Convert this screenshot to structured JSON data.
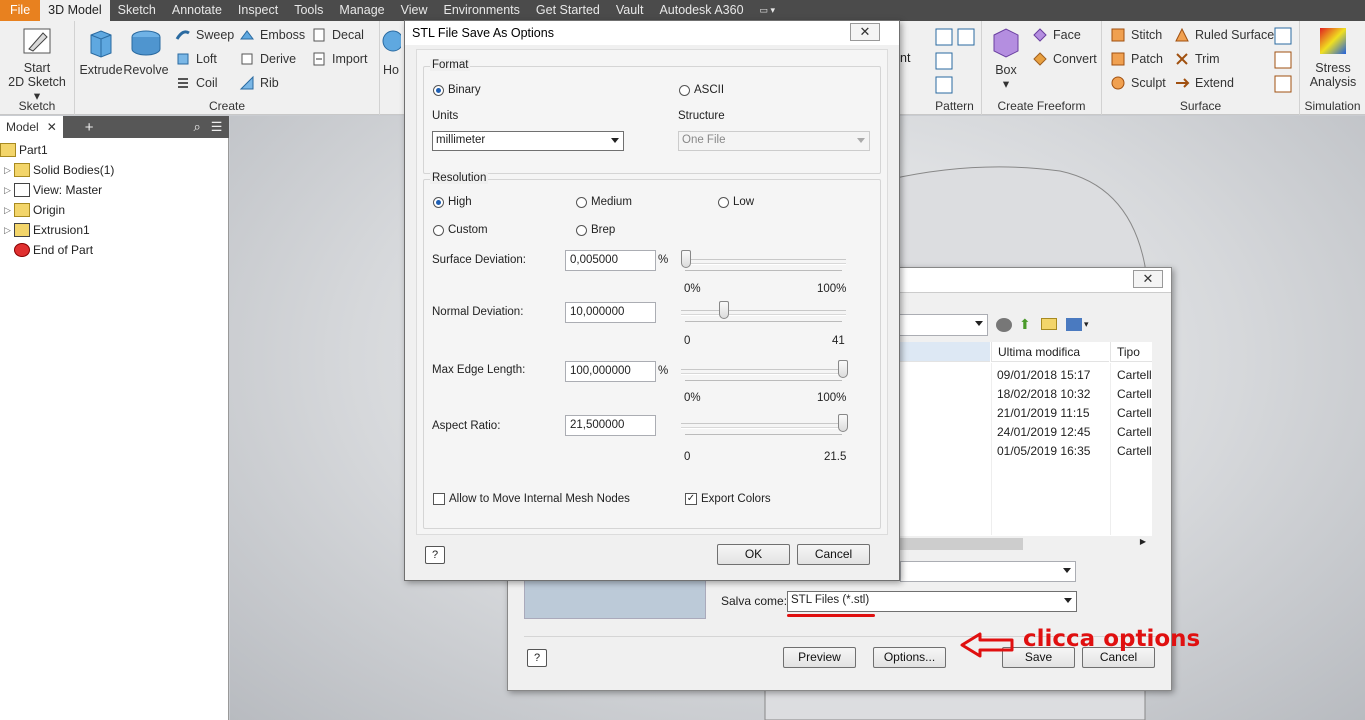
{
  "menu": [
    "File",
    "3D Model",
    "Sketch",
    "Annotate",
    "Inspect",
    "Tools",
    "Manage",
    "View",
    "Environments",
    "Get Started",
    "Vault",
    "Autodesk A360"
  ],
  "ribbon": {
    "sketch": {
      "start_label_1": "Start",
      "start_label_2": "2D Sketch",
      "group": "Sketch"
    },
    "create": {
      "extrude": "Extrude",
      "revolve": "Revolve",
      "sweep": "Sweep",
      "loft": "Loft",
      "coil": "Coil",
      "emboss": "Emboss",
      "derive": "Derive",
      "rib": "Rib",
      "decal": "Decal",
      "import": "Import",
      "hole_partial": "Ho",
      "group": "Create"
    },
    "partial_nt": "nt",
    "pattern": {
      "group": "Pattern"
    },
    "freeform": {
      "box": "Box",
      "face": "Face",
      "convert": "Convert",
      "group": "Create Freeform"
    },
    "surface": {
      "stitch": "Stitch",
      "patch": "Patch",
      "sculpt": "Sculpt",
      "ruled": "Ruled Surface",
      "trim": "Trim",
      "extend": "Extend",
      "group": "Surface"
    },
    "simulation": {
      "stress_1": "Stress",
      "stress_2": "Analysis",
      "group": "Simulation"
    }
  },
  "browser": {
    "tab": "Model",
    "items": [
      "Part1",
      "Solid Bodies(1)",
      "View: Master",
      "Origin",
      "Extrusion1",
      "End of Part"
    ]
  },
  "save_dialog": {
    "columns": [
      "Ultima modifica",
      "Tipo"
    ],
    "rows": [
      {
        "date": "09/01/2018 15:17",
        "type": "Cartell"
      },
      {
        "date": "18/02/2018 10:32",
        "type": "Cartell"
      },
      {
        "date": "21/01/2019 11:15",
        "type": "Cartell"
      },
      {
        "date": "24/01/2019 12:45",
        "type": "Cartell"
      },
      {
        "date": "01/05/2019 16:35",
        "type": "Cartell"
      }
    ],
    "save_as_label": "Salva come:",
    "save_as_value": "STL Files (*.stl)",
    "preview": "Preview",
    "options": "Options...",
    "save": "Save",
    "cancel": "Cancel"
  },
  "stl_dialog": {
    "title": "STL File Save As Options",
    "format_legend": "Format",
    "binary": "Binary",
    "ascii": "ASCII",
    "units_label": "Units",
    "units_value": "millimeter",
    "structure_label": "Structure",
    "structure_value": "One File",
    "resolution_legend": "Resolution",
    "high": "High",
    "medium": "Medium",
    "low": "Low",
    "custom": "Custom",
    "brep": "Brep",
    "surface_dev_label": "Surface Deviation:",
    "surface_dev_value": "0,005000",
    "surface_min": "0%",
    "surface_max": "100%",
    "normal_dev_label": "Normal Deviation:",
    "normal_dev_value": "10,000000",
    "normal_min": "0",
    "normal_max": "41",
    "max_edge_label": "Max Edge Length:",
    "max_edge_value": "100,000000",
    "max_edge_min": "0%",
    "max_edge_max": "100%",
    "aspect_label": "Aspect Ratio:",
    "aspect_value": "21,500000",
    "aspect_min": "0",
    "aspect_max": "21.5",
    "pct": "%",
    "allow_move": "Allow to Move Internal Mesh Nodes",
    "export_colors": "Export Colors",
    "ok": "OK",
    "cancel": "Cancel"
  },
  "annotation": "clicca options",
  "colors": {
    "file_tab": "#e8811f",
    "annotation": "#e01010",
    "menubar": "#4b4b4b"
  }
}
